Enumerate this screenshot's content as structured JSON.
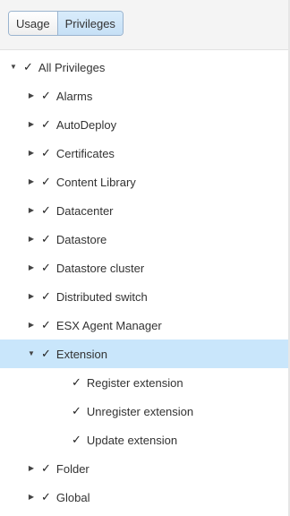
{
  "tabs": {
    "usage_label": "Usage",
    "privileges_label": "Privileges"
  },
  "tree": {
    "root": {
      "label": "All Privileges",
      "expanded": true,
      "checked": true
    },
    "items": [
      {
        "label": "Alarms",
        "expanded": false,
        "checked": true
      },
      {
        "label": "AutoDeploy",
        "expanded": false,
        "checked": true
      },
      {
        "label": "Certificates",
        "expanded": false,
        "checked": true
      },
      {
        "label": "Content Library",
        "expanded": false,
        "checked": true
      },
      {
        "label": "Datacenter",
        "expanded": false,
        "checked": true
      },
      {
        "label": "Datastore",
        "expanded": false,
        "checked": true
      },
      {
        "label": "Datastore cluster",
        "expanded": false,
        "checked": true
      },
      {
        "label": "Distributed switch",
        "expanded": false,
        "checked": true
      },
      {
        "label": "ESX Agent Manager",
        "expanded": false,
        "checked": true
      },
      {
        "label": "Extension",
        "expanded": true,
        "checked": true,
        "selected": true
      },
      {
        "label": "Folder",
        "expanded": false,
        "checked": true
      },
      {
        "label": "Global",
        "expanded": false,
        "checked": true
      }
    ],
    "extension_children": [
      {
        "label": "Register extension",
        "checked": true
      },
      {
        "label": "Unregister extension",
        "checked": true
      },
      {
        "label": "Update extension",
        "checked": true
      }
    ]
  },
  "colors": {
    "selected_row": "#c9e6fb",
    "active_tab": "#c6e0f6",
    "tab_border": "#9ab4cf"
  },
  "icons": {
    "expanded": "caret-down-icon",
    "collapsed": "caret-right-icon",
    "check": "checkmark-icon"
  }
}
